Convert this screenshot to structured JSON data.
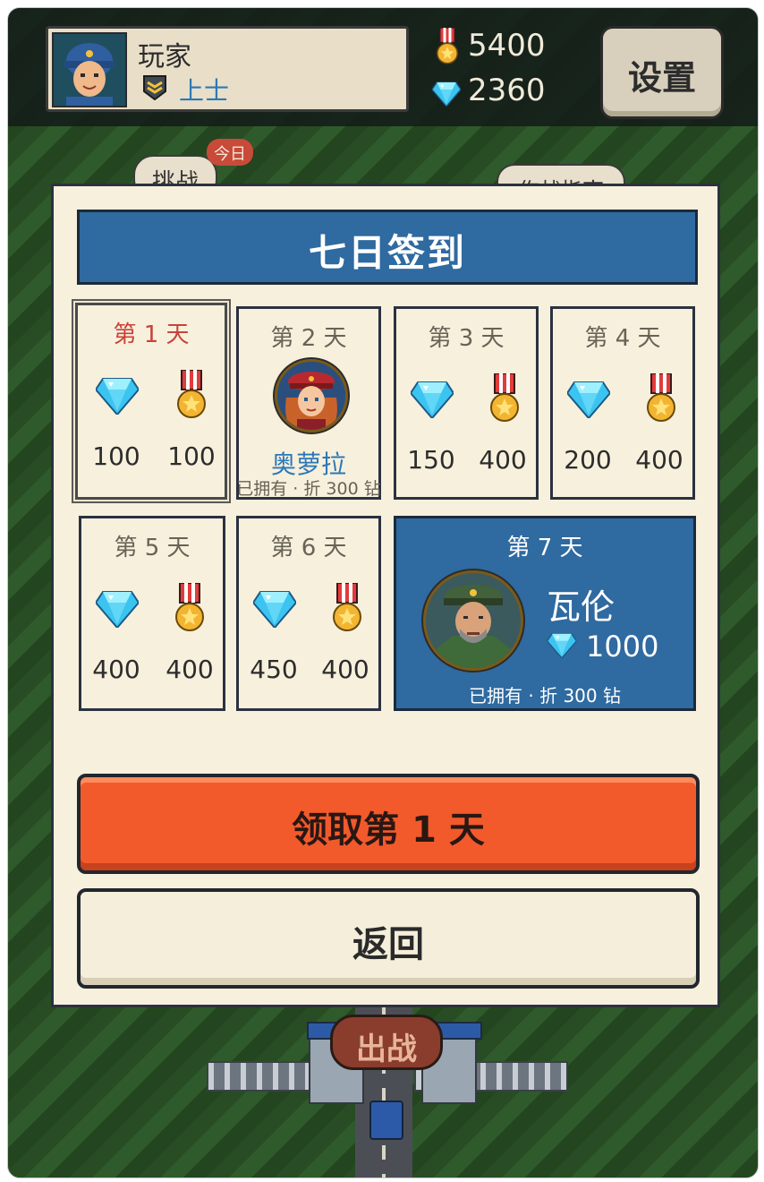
{
  "header": {
    "player_name": "玩家",
    "rank_name": "上士",
    "medals": "5400",
    "gems": "2360",
    "settings_label": "设置"
  },
  "background": {
    "challenge_label": "挑战",
    "today_badge": "今日",
    "guide_label": "作战指南",
    "deploy_label": "出战"
  },
  "modal": {
    "title": "七日签到",
    "days": [
      {
        "label": "第 1 天",
        "gems": "100",
        "medals": "100"
      },
      {
        "label": "第 2 天",
        "character": "奥萝拉",
        "note": "已拥有 · 折 300 钻"
      },
      {
        "label": "第 3 天",
        "gems": "150",
        "medals": "400"
      },
      {
        "label": "第 4 天",
        "gems": "200",
        "medals": "400"
      },
      {
        "label": "第 5 天",
        "gems": "400",
        "medals": "400"
      },
      {
        "label": "第 6 天",
        "gems": "450",
        "medals": "400"
      },
      {
        "label": "第 7 天",
        "character": "瓦伦",
        "gems": "1000",
        "note": "已拥有 · 折 300 钻"
      }
    ],
    "claim_label": "领取第 1 天",
    "back_label": "返回"
  },
  "colors": {
    "accent_blue": "#2f6aa0",
    "claim_orange": "#f25a2c",
    "today_red": "#c9433a",
    "panel_cream": "#f7f0dc"
  },
  "icons": [
    "soldier-avatar",
    "rank-chevron-icon",
    "medal-icon",
    "gem-icon"
  ]
}
